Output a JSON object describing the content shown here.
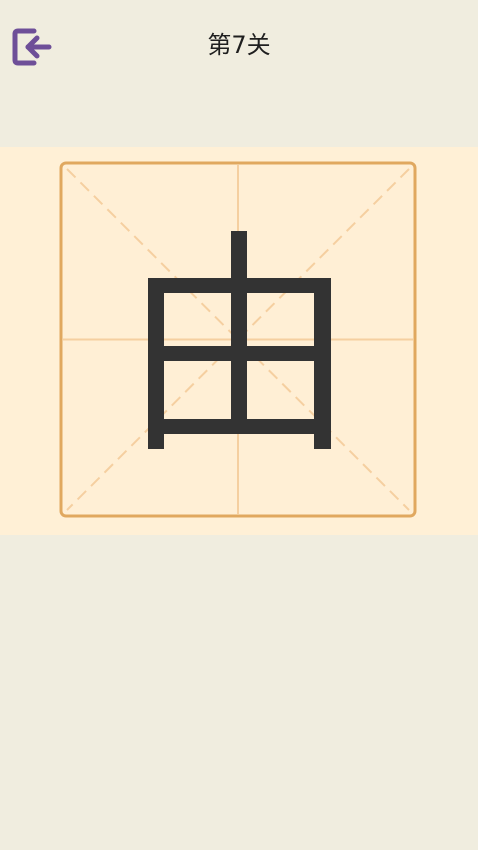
{
  "header": {
    "back_icon": "exit-arrow-icon",
    "title": "第7关"
  },
  "board": {
    "character": "由",
    "grid_type": "tian-mi-ge",
    "colors": {
      "band_background": "#fff0d6",
      "grid_border": "#e0a85f",
      "grid_guides": "#f5cfa0",
      "character": "#333333",
      "back_icon": "#6e4f98"
    }
  }
}
